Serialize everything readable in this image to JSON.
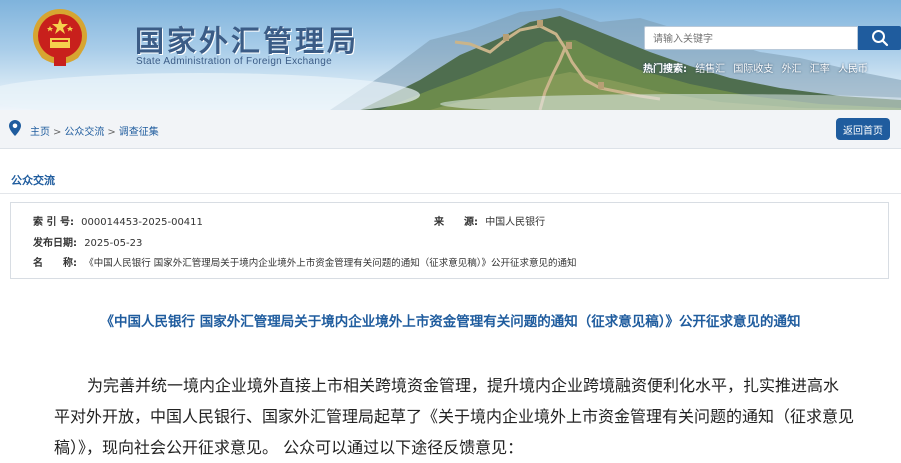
{
  "header": {
    "site_title": "国家外汇管理局",
    "site_subtitle": "State Administration of Foreign Exchange",
    "search_placeholder": "请输入关键字",
    "hot_label": "热门搜索:",
    "hot_terms": [
      "结售汇",
      "国际收支",
      "外汇",
      "汇率",
      "人民币"
    ]
  },
  "breadcrumb": {
    "items": [
      "主页",
      "公众交流",
      "调查征集"
    ],
    "separator": ">",
    "home_button": "返回首页"
  },
  "section": {
    "title": "公众交流"
  },
  "meta": {
    "index_label": "索 引 号:",
    "index_value": "000014453-2025-00411",
    "source_label": "来　　源:",
    "source_value": "中国人民银行",
    "date_label": "发布日期:",
    "date_value": "2025-05-23",
    "name_label": "名　　称:",
    "name_value": "《中国人民银行 国家外汇管理局关于境内企业境外上市资金管理有关问题的通知（征求意见稿）》公开征求意见的通知"
  },
  "article": {
    "title": "《中国人民银行 国家外汇管理局关于境内企业境外上市资金管理有关问题的通知（征求意见稿）》公开征求意见的通知",
    "body": "为完善并统一境内企业境外直接上市相关跨境资金管理，提升境内企业跨境融资便利化水平，扎实推进高水平对外开放，中国人民银行、国家外汇管理局起草了《关于境内企业境外上市资金管理有关问题的通知（征求意见稿）》，现向社会公开征求意见。 公众可以通过以下途径反馈意见："
  },
  "colors": {
    "brand_blue": "#1f5c9e",
    "title_blue": "#3b5c86",
    "crumb_bg": "#f2f4f7"
  },
  "icons": [
    "national-emblem-icon",
    "search-icon",
    "location-pin-icon"
  ]
}
